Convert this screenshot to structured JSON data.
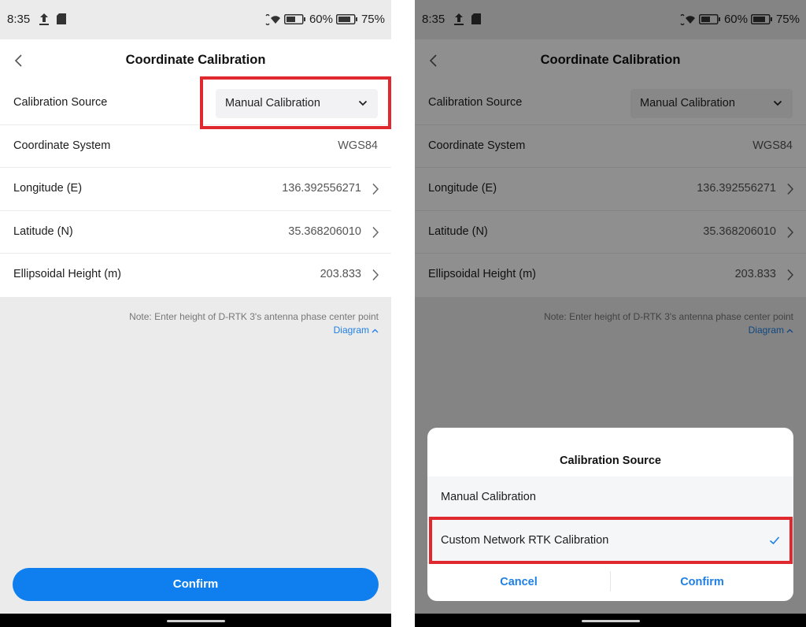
{
  "status_bar": {
    "time": "8:35",
    "battery_1": "60%",
    "battery_2": "75%",
    "icons": [
      "upload-icon",
      "sd-card-icon",
      "signal-icon",
      "battery-icon",
      "battery-icon"
    ]
  },
  "header": {
    "title": "Coordinate Calibration",
    "back_icon": "chevron-left-icon"
  },
  "rows": {
    "calibration_source": {
      "label": "Calibration Source",
      "value": "Manual Calibration"
    },
    "coordinate_system": {
      "label": "Coordinate System",
      "value": "WGS84"
    },
    "longitude": {
      "label": "Longitude (E)",
      "value": "136.392556271"
    },
    "latitude": {
      "label": "Latitude (N)",
      "value": "35.368206010"
    },
    "height": {
      "label": "Ellipsoidal Height (m)",
      "value": "203.833"
    }
  },
  "note": {
    "text": "Note: Enter height of D-RTK 3's antenna phase center point",
    "diagram_link": "Diagram"
  },
  "confirm_button": "Confirm",
  "sheet": {
    "title": "Calibration Source",
    "options": [
      {
        "label": "Manual Calibration",
        "selected": false
      },
      {
        "label": "Custom Network RTK Calibration",
        "selected": true
      }
    ],
    "cancel": "Cancel",
    "confirm": "Confirm"
  },
  "colors": {
    "accent": "#0f7ff0",
    "link": "#1f7fe5",
    "highlight": "#e0282f"
  }
}
